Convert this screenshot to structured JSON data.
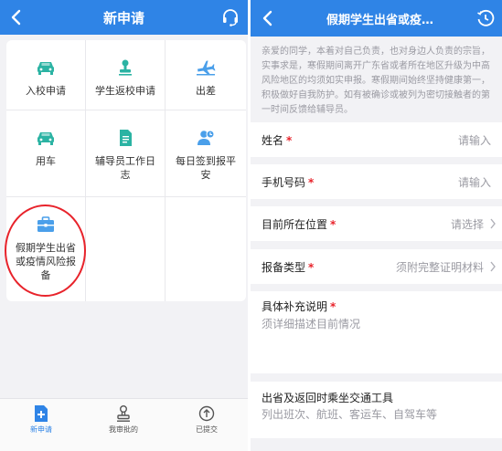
{
  "left_screen": {
    "header": {
      "title": "新申请"
    },
    "grid_items": [
      {
        "label": "入校申请",
        "icon": "car-icon"
      },
      {
        "label": "学生返校申请",
        "icon": "stamp-icon"
      },
      {
        "label": "出差",
        "icon": "plane-icon"
      },
      {
        "label": "用车",
        "icon": "car-icon"
      },
      {
        "label": "辅导员工作日志",
        "icon": "document-icon"
      },
      {
        "label": "每日签到报平安",
        "icon": "user-checkin-icon"
      },
      {
        "label": "假期学生出省或疫情风险报备",
        "icon": "briefcase-icon"
      }
    ],
    "tabbar": [
      {
        "label": "新申请",
        "icon": "new-doc-icon",
        "active": true
      },
      {
        "label": "我审批的",
        "icon": "stamp-icon",
        "active": false
      },
      {
        "label": "已提交",
        "icon": "upload-icon",
        "active": false
      }
    ],
    "accent_color": "#2f84e6",
    "highlight_color": "#e8232b"
  },
  "right_screen": {
    "header": {
      "title": "假期学生出省或疫…"
    },
    "notice": "亲爱的同学，本着对自己负责，也对身边人负责的宗旨，实事求是，寒假期间离开广东省或者所在地区升级为中高风险地区的均须如实申报。寒假期间始终坚持健康第一，积极做好自我防护。如有被确诊或被列为密切接触者的第一时间反馈给辅导员。",
    "fields": {
      "name": {
        "label": "姓名",
        "required": "*",
        "value": "请输入"
      },
      "phone": {
        "label": "手机号码",
        "required": "*",
        "value": "请输入"
      },
      "location": {
        "label": "目前所在位置",
        "required": "*",
        "value": "请选择"
      },
      "report_type": {
        "label": "报备类型",
        "required": "*",
        "value": "须附完整证明材料"
      },
      "details": {
        "label": "具体补充说明",
        "required": "*",
        "placeholder": "须详细描述目前情况"
      },
      "transport": {
        "label": "出省及返回时乘坐交通工具",
        "placeholder": "列出班次、航班、客运车、自驾车等"
      }
    }
  }
}
